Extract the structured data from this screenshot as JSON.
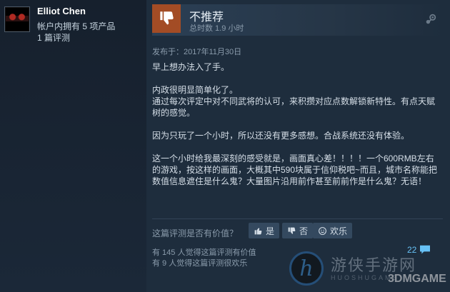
{
  "user": {
    "name": "Elliot Chen",
    "owned": "帐户内拥有 5 项产品",
    "reviews": "1 篇评测"
  },
  "review": {
    "verdict": "不推荐",
    "hours": "总时数 1.9 小时",
    "posted": "发布于：2017年11月30日",
    "paragraphs": [
      "早上想办法入了手。",
      "内政很明显简单化了。\n通过每次评定中对不同武将的认可，来积攒对应点数解锁新特性。有点天赋树的感觉。",
      "因为只玩了一个小时，所以还没有更多感想。合战系统还没有体验。",
      "这一个小时给我最深刻的感受就是，画面真心差！！！！一个600RMB左右的游戏，按这样的画面，大概其中590块属于信仰税吧~而且，城市名称能把数值信息遮住是什么鬼？大量图片沿用前作甚至前前作是什么鬼？无语！"
    ]
  },
  "helpful": {
    "question": "这篇评测是否有价值？",
    "yes_label": "是",
    "no_label": "否",
    "funny_label": "欢乐",
    "helpful_stat": "有 145 人觉得这篇评测有价值",
    "funny_stat": "有 9 人觉得这篇评测很欢乐",
    "comment_count": "22"
  },
  "watermark": {
    "letter": "h",
    "site_cn": "游侠手游网",
    "site_en": "HUOSHUGAME",
    "brand": "3DMGAME"
  },
  "colors": {
    "background": "#1b2838",
    "thumb_down": "#a34c25",
    "link": "#67c1f5"
  }
}
